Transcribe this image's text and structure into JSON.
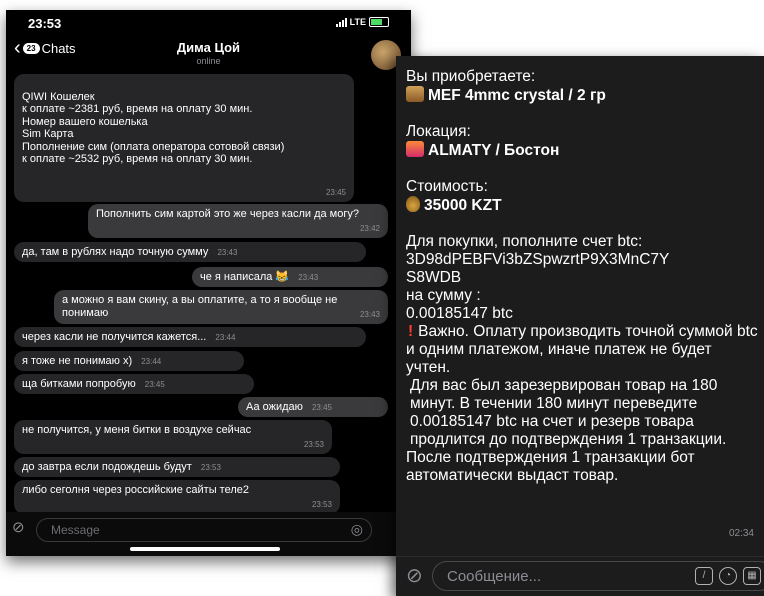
{
  "left": {
    "status": {
      "time": "23:53",
      "network": "LTE"
    },
    "header": {
      "back_label": "Chats",
      "unread_count": "23",
      "contact_name": "Дима Цой",
      "contact_status": "online"
    },
    "messages": [
      {
        "text": "QIWI Кошелек\nк оплате ~2381 руб, время на оплату 30 мин.\nНомер вашего кошелька\nSim Карта\nПополнение сим (оплата оператора сотовой связи)\nк оплате ~2532 руб, время на оплату 30 мин.",
        "time": "23:45",
        "dir": "in"
      },
      {
        "text": "Пополнить сим картой это же через касли да могу?",
        "time": "23:42",
        "dir": "out"
      },
      {
        "text": "да, там в рублях надо точную сумму",
        "time": "23:43",
        "dir": "in"
      },
      {
        "text": "че я написала 😹",
        "time": "23:43",
        "dir": "out"
      },
      {
        "text": "а можно я вам скину, а вы оплатите, а то я вообще не понимаю",
        "time": "23:43",
        "dir": "out"
      },
      {
        "text": "через касли не получится кажется...",
        "time": "23:44",
        "dir": "in"
      },
      {
        "text": "я тоже не понимаю х)",
        "time": "23:44",
        "dir": "in"
      },
      {
        "text": "ща битками попробую",
        "time": "23:45",
        "dir": "in"
      },
      {
        "text": "Аа ожидаю",
        "time": "23:45",
        "dir": "out"
      },
      {
        "text": "не получится, у меня битки в воздухе сейчас",
        "time": "23:53",
        "dir": "in"
      },
      {
        "text": "до завтра если подождешь будут",
        "time": "23:53",
        "dir": "in"
      },
      {
        "text": "либо сеголня через российские сайты теле2",
        "time": "23:53",
        "dir": "in"
      }
    ],
    "composer": {
      "placeholder": "Message"
    }
  },
  "right": {
    "message": {
      "buy_label": "Вы приобретаете:",
      "product": "MEF 4mmc crystal  / 2 гр",
      "location_label": "Локация:",
      "location": "ALMATY / Бостон",
      "price_label": "Стоимость:",
      "price": "35000 KZT",
      "pay_line1": "Для покупки, пополните счет btc:",
      "address_line1": "3D98dPEBFVi3bZSpwzrtP9X3MnC7Y",
      "address_line2": "S8WDB",
      "sum_label": "на сумму :",
      "sum_value": "0.00185147 btc",
      "warning": "Важно. Оплату производить точной суммой btc и одним платежом, иначе платеж не будет учтен.",
      "reserve": "Для вас был зарезервирован товар на 180 минут. В течении 180 минут переведите 0.00185147 btc на счет и резерв товара продлится до подтверждения 1 транзакции.",
      "after": "После подтверждения 1 транзакции бот автоматически выдаст товар.",
      "time": "02:34"
    },
    "composer": {
      "placeholder": "Сообщение..."
    }
  },
  "icons": [
    "back-chevron-icon",
    "signal-icon",
    "battery-icon",
    "attach-icon",
    "sticker-icon",
    "mic-icon",
    "box-emoji-icon",
    "city-emoji-icon",
    "money-bag-emoji-icon",
    "exclamation-icon",
    "bot-command-icon",
    "clock-icon"
  ],
  "colors": {
    "phone_bg": "#000000",
    "bubble_in": "#262628",
    "bubble_out": "#3a3a3c",
    "card_bg": "#1c1c1d",
    "warning": "#ff3b30"
  }
}
